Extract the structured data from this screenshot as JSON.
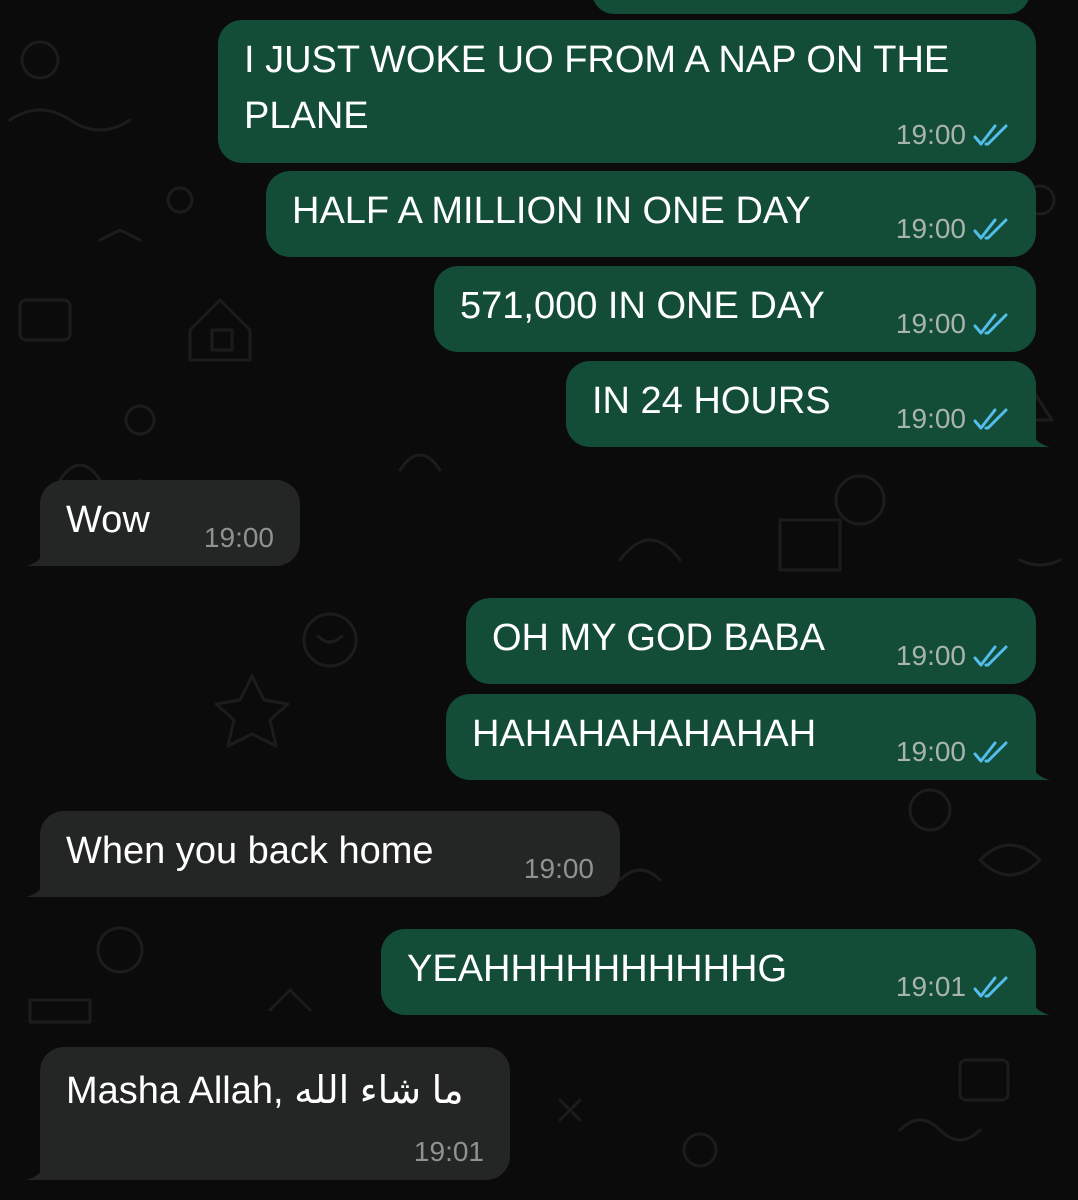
{
  "chat": {
    "messages": [
      {
        "direction": "out",
        "text_lines": [
          "I JUST WOKE UO FROM A NAP ON THE",
          "PLANE"
        ],
        "time": "19:00",
        "status_icon": "double-check-read-icon"
      },
      {
        "direction": "out",
        "text_lines": [
          "HALF A MILLION IN ONE DAY"
        ],
        "time": "19:00",
        "status_icon": "double-check-read-icon"
      },
      {
        "direction": "out",
        "text_lines": [
          "571,000 IN ONE DAY"
        ],
        "time": "19:00",
        "status_icon": "double-check-read-icon"
      },
      {
        "direction": "out",
        "text_lines": [
          "IN 24 HOURS"
        ],
        "time": "19:00",
        "status_icon": "double-check-read-icon"
      },
      {
        "direction": "in",
        "text_lines": [
          "Wow"
        ],
        "time": "19:00"
      },
      {
        "direction": "out",
        "text_lines": [
          "OH MY GOD BABA"
        ],
        "time": "19:00",
        "status_icon": "double-check-read-icon"
      },
      {
        "direction": "out",
        "text_lines": [
          "HAHAHAHAHAHAH"
        ],
        "time": "19:00",
        "status_icon": "double-check-read-icon"
      },
      {
        "direction": "in",
        "text_lines": [
          "When you back home"
        ],
        "time": "19:00"
      },
      {
        "direction": "out",
        "text_lines": [
          "YEAHHHHHHHHHHG"
        ],
        "time": "19:01",
        "status_icon": "double-check-read-icon"
      },
      {
        "direction": "in",
        "text_lines": [
          "Masha Allah, ما شاء الله"
        ],
        "time": "19:01"
      }
    ]
  },
  "colors": {
    "background": "#0b0b0b",
    "outgoing_bubble": "#134d37",
    "incoming_bubble": "#242626",
    "read_ticks": "#53bdeb",
    "timestamp": "#a8b4ad"
  }
}
